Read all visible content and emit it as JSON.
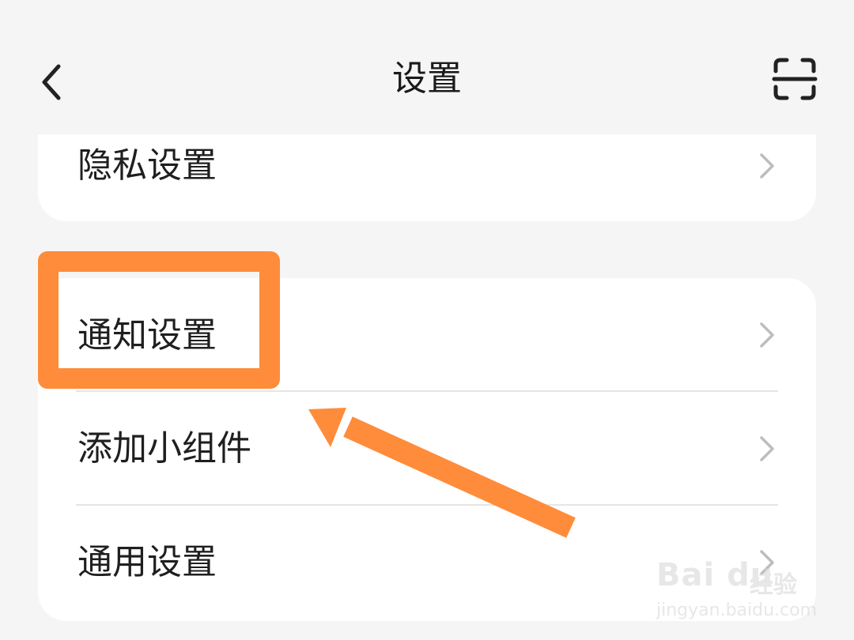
{
  "header": {
    "title": "设置",
    "back_icon": "chevron-left-icon",
    "scan_icon": "scan-icon"
  },
  "top_card": {
    "items": [
      {
        "label": "隐私设置",
        "icon": "chevron-right-icon"
      }
    ]
  },
  "main_card": {
    "items": [
      {
        "label": "通知设置",
        "icon": "chevron-right-icon"
      },
      {
        "label": "添加小组件",
        "icon": "chevron-right-icon"
      },
      {
        "label": "通用设置",
        "icon": "chevron-right-icon"
      }
    ]
  },
  "annotation": {
    "highlight_color": "#ff8c3a",
    "arrow_color": "#ff8c3a"
  },
  "watermark": {
    "brand": "Bai du",
    "brand_cn": "经验",
    "url": "jingyan.baidu.com"
  }
}
